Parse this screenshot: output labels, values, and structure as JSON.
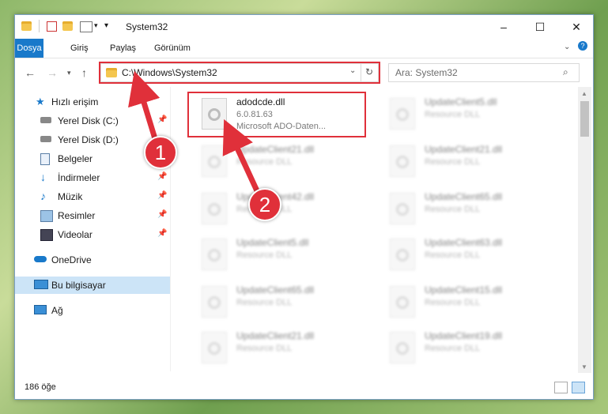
{
  "window": {
    "title": "System32"
  },
  "ribbon": {
    "tabs": [
      "Dosya",
      "Giriş",
      "Paylaş",
      "Görünüm"
    ]
  },
  "address": {
    "path": "C:\\Windows\\System32"
  },
  "search": {
    "placeholder": "Ara: System32"
  },
  "sidebar": {
    "items": [
      {
        "label": "Hızlı erişim",
        "icon": "star-icon"
      },
      {
        "label": "Yerel Disk (C:)",
        "icon": "drive-icon"
      },
      {
        "label": "Yerel Disk (D:)",
        "icon": "drive-icon"
      },
      {
        "label": "Belgeler",
        "icon": "documents-icon"
      },
      {
        "label": "İndirmeler",
        "icon": "download-icon"
      },
      {
        "label": "Müzik",
        "icon": "music-icon"
      },
      {
        "label": "Resimler",
        "icon": "pictures-icon"
      },
      {
        "label": "Videolar",
        "icon": "video-icon"
      },
      {
        "label": "OneDrive",
        "icon": "cloud-icon"
      },
      {
        "label": "Bu bilgisayar",
        "icon": "computer-icon"
      },
      {
        "label": "Ağ",
        "icon": "network-icon"
      }
    ]
  },
  "files": [
    {
      "name": "adodcde.dll",
      "line1": "6.0.81.63",
      "line2": "Microsoft ADO-Daten..."
    },
    {
      "name": "UpdateClient5.dll",
      "line1": "Resource DLL"
    },
    {
      "name": "UpdateClient21.dll",
      "line1": "Resource DLL"
    },
    {
      "name": "UpdateClient21.dll",
      "line1": "Resource DLL"
    },
    {
      "name": "UpdateClient42.dll",
      "line1": "Resource DLL"
    },
    {
      "name": "UpdateClient65.dll",
      "line1": "Resource DLL"
    },
    {
      "name": "UpdateClient5.dll",
      "line1": "Resource DLL"
    },
    {
      "name": "UpdateClient63.dll",
      "line1": "Resource DLL"
    },
    {
      "name": "UpdateClient65.dll",
      "line1": "Resource DLL"
    },
    {
      "name": "UpdateClient15.dll",
      "line1": "Resource DLL"
    },
    {
      "name": "UpdateClient21.dll",
      "line1": "Resource DLL"
    },
    {
      "name": "UpdateClient19.dll",
      "line1": "Resource DLL"
    }
  ],
  "status": {
    "count": "186 öğe"
  },
  "annotations": {
    "badge1": "1",
    "badge2": "2"
  },
  "colors": {
    "accent": "#1979ca",
    "annotation": "#e0303a"
  }
}
